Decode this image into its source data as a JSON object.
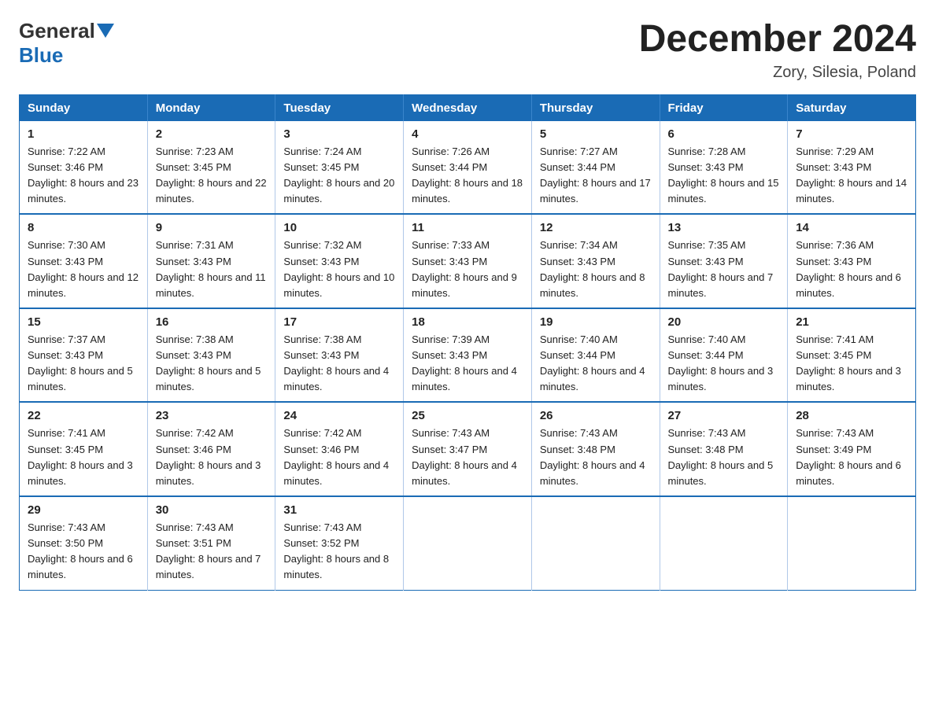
{
  "header": {
    "logo_general": "General",
    "logo_blue": "Blue",
    "month_title": "December 2024",
    "location": "Zory, Silesia, Poland"
  },
  "days_of_week": [
    "Sunday",
    "Monday",
    "Tuesday",
    "Wednesday",
    "Thursday",
    "Friday",
    "Saturday"
  ],
  "weeks": [
    [
      {
        "day": "1",
        "sunrise": "7:22 AM",
        "sunset": "3:46 PM",
        "daylight": "8 hours and 23 minutes."
      },
      {
        "day": "2",
        "sunrise": "7:23 AM",
        "sunset": "3:45 PM",
        "daylight": "8 hours and 22 minutes."
      },
      {
        "day": "3",
        "sunrise": "7:24 AM",
        "sunset": "3:45 PM",
        "daylight": "8 hours and 20 minutes."
      },
      {
        "day": "4",
        "sunrise": "7:26 AM",
        "sunset": "3:44 PM",
        "daylight": "8 hours and 18 minutes."
      },
      {
        "day": "5",
        "sunrise": "7:27 AM",
        "sunset": "3:44 PM",
        "daylight": "8 hours and 17 minutes."
      },
      {
        "day": "6",
        "sunrise": "7:28 AM",
        "sunset": "3:43 PM",
        "daylight": "8 hours and 15 minutes."
      },
      {
        "day": "7",
        "sunrise": "7:29 AM",
        "sunset": "3:43 PM",
        "daylight": "8 hours and 14 minutes."
      }
    ],
    [
      {
        "day": "8",
        "sunrise": "7:30 AM",
        "sunset": "3:43 PM",
        "daylight": "8 hours and 12 minutes."
      },
      {
        "day": "9",
        "sunrise": "7:31 AM",
        "sunset": "3:43 PM",
        "daylight": "8 hours and 11 minutes."
      },
      {
        "day": "10",
        "sunrise": "7:32 AM",
        "sunset": "3:43 PM",
        "daylight": "8 hours and 10 minutes."
      },
      {
        "day": "11",
        "sunrise": "7:33 AM",
        "sunset": "3:43 PM",
        "daylight": "8 hours and 9 minutes."
      },
      {
        "day": "12",
        "sunrise": "7:34 AM",
        "sunset": "3:43 PM",
        "daylight": "8 hours and 8 minutes."
      },
      {
        "day": "13",
        "sunrise": "7:35 AM",
        "sunset": "3:43 PM",
        "daylight": "8 hours and 7 minutes."
      },
      {
        "day": "14",
        "sunrise": "7:36 AM",
        "sunset": "3:43 PM",
        "daylight": "8 hours and 6 minutes."
      }
    ],
    [
      {
        "day": "15",
        "sunrise": "7:37 AM",
        "sunset": "3:43 PM",
        "daylight": "8 hours and 5 minutes."
      },
      {
        "day": "16",
        "sunrise": "7:38 AM",
        "sunset": "3:43 PM",
        "daylight": "8 hours and 5 minutes."
      },
      {
        "day": "17",
        "sunrise": "7:38 AM",
        "sunset": "3:43 PM",
        "daylight": "8 hours and 4 minutes."
      },
      {
        "day": "18",
        "sunrise": "7:39 AM",
        "sunset": "3:43 PM",
        "daylight": "8 hours and 4 minutes."
      },
      {
        "day": "19",
        "sunrise": "7:40 AM",
        "sunset": "3:44 PM",
        "daylight": "8 hours and 4 minutes."
      },
      {
        "day": "20",
        "sunrise": "7:40 AM",
        "sunset": "3:44 PM",
        "daylight": "8 hours and 3 minutes."
      },
      {
        "day": "21",
        "sunrise": "7:41 AM",
        "sunset": "3:45 PM",
        "daylight": "8 hours and 3 minutes."
      }
    ],
    [
      {
        "day": "22",
        "sunrise": "7:41 AM",
        "sunset": "3:45 PM",
        "daylight": "8 hours and 3 minutes."
      },
      {
        "day": "23",
        "sunrise": "7:42 AM",
        "sunset": "3:46 PM",
        "daylight": "8 hours and 3 minutes."
      },
      {
        "day": "24",
        "sunrise": "7:42 AM",
        "sunset": "3:46 PM",
        "daylight": "8 hours and 4 minutes."
      },
      {
        "day": "25",
        "sunrise": "7:43 AM",
        "sunset": "3:47 PM",
        "daylight": "8 hours and 4 minutes."
      },
      {
        "day": "26",
        "sunrise": "7:43 AM",
        "sunset": "3:48 PM",
        "daylight": "8 hours and 4 minutes."
      },
      {
        "day": "27",
        "sunrise": "7:43 AM",
        "sunset": "3:48 PM",
        "daylight": "8 hours and 5 minutes."
      },
      {
        "day": "28",
        "sunrise": "7:43 AM",
        "sunset": "3:49 PM",
        "daylight": "8 hours and 6 minutes."
      }
    ],
    [
      {
        "day": "29",
        "sunrise": "7:43 AM",
        "sunset": "3:50 PM",
        "daylight": "8 hours and 6 minutes."
      },
      {
        "day": "30",
        "sunrise": "7:43 AM",
        "sunset": "3:51 PM",
        "daylight": "8 hours and 7 minutes."
      },
      {
        "day": "31",
        "sunrise": "7:43 AM",
        "sunset": "3:52 PM",
        "daylight": "8 hours and 8 minutes."
      },
      null,
      null,
      null,
      null
    ]
  ],
  "labels": {
    "sunrise": "Sunrise:",
    "sunset": "Sunset:",
    "daylight": "Daylight:"
  }
}
